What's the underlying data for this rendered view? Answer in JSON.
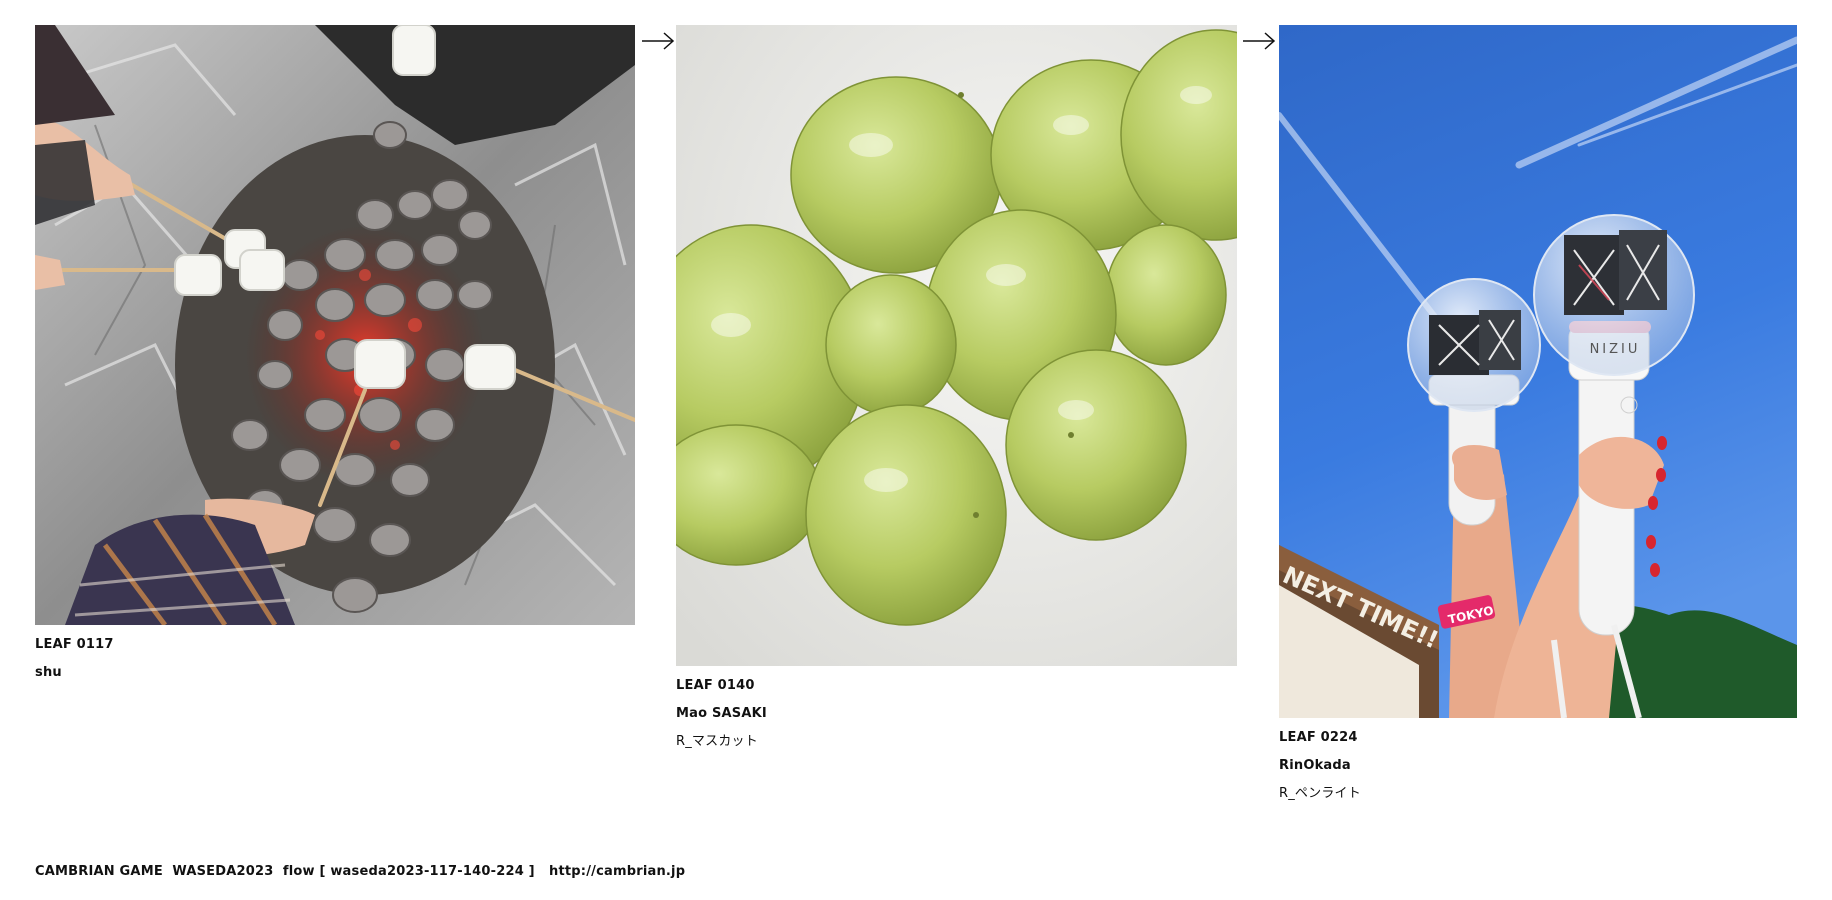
{
  "leaves": [
    {
      "leaf_id": "LEAF 0117",
      "author": "shu",
      "title": "",
      "photo_subject": "marshmallows-over-charcoal-photo"
    },
    {
      "leaf_id": "LEAF 0140",
      "author": "Mao SASAKI",
      "title": "R_マスカット",
      "photo_subject": "green-grapes-photo"
    },
    {
      "leaf_id": "LEAF 0224",
      "author": "RinOkada",
      "title": "R_ペンライト",
      "photo_subject": "penlights-sky-photo",
      "photo_text": {
        "stick_brand": "NIZIU",
        "banner": "NEXT TIME!!",
        "wristband": "TOKYO"
      }
    }
  ],
  "arrows": [
    "right-arrow-icon",
    "right-arrow-icon"
  ],
  "footer": {
    "label": "CAMBRIAN GAME  WASEDA2023  flow [ waseda2023-117-140-224 ]",
    "url": "http://cambrian.jp"
  }
}
